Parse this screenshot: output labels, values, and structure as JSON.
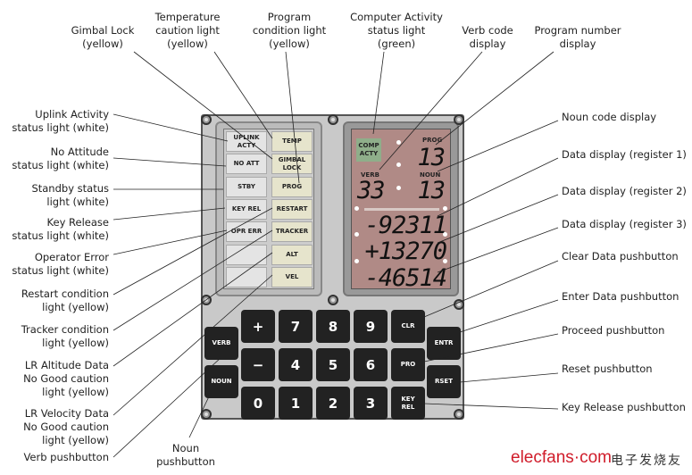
{
  "left_labels": [
    "Uplink Activity\nstatus light (white)",
    "No Attitude\nstatus light (white)",
    "Standby status\nlight (white)",
    "Key Release\nstatus light (white)",
    "Operator Error\nstatus light (white)",
    "Restart condition\nlight (yellow)",
    "Tracker condition\nlight (yellow)",
    "LR Altitude Data\nNo Good caution\nlight (yellow)",
    "LR Velocity Data\nNo Good caution\nlight (yellow)",
    "Verb pushbutton"
  ],
  "noun_label": "Noun\npushbutton",
  "top_labels": [
    "Gimbal Lock\n(yellow)",
    "Temperature\ncaution light\n(yellow)",
    "Program\ncondition light\n(yellow)",
    "Computer Activity\nstatus light\n(green)",
    "Verb code\ndisplay",
    "Program number\ndisplay"
  ],
  "right_labels": [
    "Noun code display",
    "Data display (register 1)",
    "Data display (register 2)",
    "Data display (register 3)",
    "Clear Data pushbutton",
    "Enter Data pushbutton",
    "Proceed pushbutton",
    "Reset pushbutton",
    "Key Release pushbutton"
  ],
  "lamps_left": [
    "UPLINK\nACTY",
    "NO ATT",
    "STBY",
    "KEY REL",
    "OPR ERR",
    "",
    ""
  ],
  "lamps_right": [
    "TEMP",
    "GIMBAL\nLOCK",
    "PROG",
    "RESTART",
    "TRACKER",
    "ALT",
    "VEL"
  ],
  "display": {
    "comp_acty": "COMP\nACTY",
    "prog_label": "PROG",
    "verb_label": "VERB",
    "noun_label": "NOUN",
    "prog": "13",
    "verb": "33",
    "noun": "13",
    "r1": "-92311",
    "r2": "+13270",
    "r3": "-46514"
  },
  "keys": {
    "verb": "VERB",
    "noun": "NOUN",
    "grid": [
      [
        "+",
        "7",
        "8",
        "9",
        "CLR"
      ],
      [
        "−",
        "4",
        "5",
        "6",
        "PRO"
      ],
      [
        "0",
        "1",
        "2",
        "3",
        "KEY\nREL"
      ]
    ],
    "entr": "ENTR",
    "rset": "RSET"
  },
  "colors": {
    "white_lamp": "#e4e4e4",
    "yellow_lamp": "#e6e4cc",
    "comp_acty": "#8fae8a",
    "display_bg": "#b08a86",
    "key": "#222222"
  },
  "watermark": {
    "logo": "elecfans·com",
    "cn": "电子发烧友"
  }
}
